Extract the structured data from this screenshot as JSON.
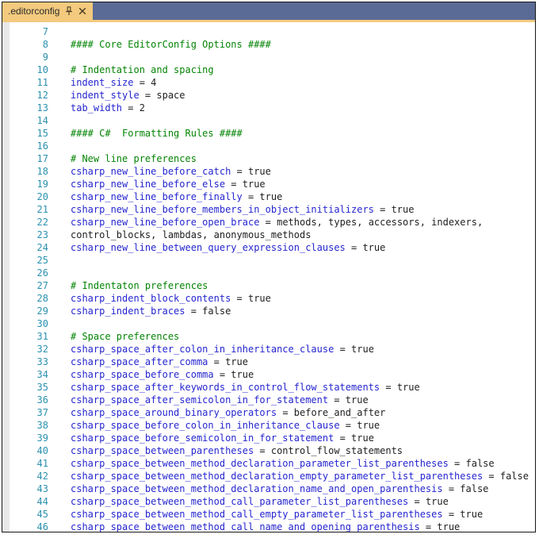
{
  "tab": {
    "title": ".editorconfig",
    "close_glyph": "✕",
    "pin_icon": "pushpin-pinned",
    "close_icon": "close-x"
  },
  "colors": {
    "tab_bar_background": "#5a6b96",
    "active_tab_background": "#f3ca7e",
    "line_number": "#2b91af",
    "comment_green": "#048404",
    "key_blue": "#2525cf",
    "value_text": "#1e1e1e",
    "gutter_gray": "#e8e8e8"
  },
  "editor": {
    "lines": [
      {
        "num": "7",
        "segs": []
      },
      {
        "num": "8",
        "segs": [
          {
            "c": "comment",
            "t": "#### Core EditorConfig Options ####"
          }
        ]
      },
      {
        "num": "9",
        "segs": []
      },
      {
        "num": "10",
        "segs": [
          {
            "c": "comment",
            "t": "# Indentation and spacing"
          }
        ]
      },
      {
        "num": "11",
        "segs": [
          {
            "c": "key",
            "t": "indent_size"
          },
          {
            "c": "val",
            "t": " = 4"
          }
        ]
      },
      {
        "num": "12",
        "segs": [
          {
            "c": "key",
            "t": "indent_style"
          },
          {
            "c": "val",
            "t": " = space"
          }
        ]
      },
      {
        "num": "13",
        "segs": [
          {
            "c": "key",
            "t": "tab_width"
          },
          {
            "c": "val",
            "t": " = 2"
          }
        ]
      },
      {
        "num": "14",
        "segs": []
      },
      {
        "num": "15",
        "segs": [
          {
            "c": "comment",
            "t": "#### C#  Formatting Rules ####"
          }
        ]
      },
      {
        "num": "16",
        "segs": []
      },
      {
        "num": "17",
        "segs": [
          {
            "c": "comment",
            "t": "# New line preferences"
          }
        ]
      },
      {
        "num": "18",
        "segs": [
          {
            "c": "key",
            "t": "csharp_new_line_before_catch"
          },
          {
            "c": "val",
            "t": " = true"
          }
        ]
      },
      {
        "num": "19",
        "segs": [
          {
            "c": "key",
            "t": "csharp_new_line_before_else"
          },
          {
            "c": "val",
            "t": " = true"
          }
        ]
      },
      {
        "num": "20",
        "segs": [
          {
            "c": "key",
            "t": "csharp_new_line_before_finally"
          },
          {
            "c": "val",
            "t": " = true"
          }
        ]
      },
      {
        "num": "21",
        "segs": [
          {
            "c": "key",
            "t": "csharp_new_line_before_members_in_object_initializers"
          },
          {
            "c": "val",
            "t": " = true"
          }
        ]
      },
      {
        "num": "22",
        "segs": [
          {
            "c": "key",
            "t": "csharp_new_line_before_open_brace"
          },
          {
            "c": "val",
            "t": " = methods, types, accessors, indexers,"
          }
        ]
      },
      {
        "num": "23",
        "segs": [
          {
            "c": "val",
            "t": "control_blocks, lambdas, anonymous_methods"
          }
        ]
      },
      {
        "num": "24",
        "segs": [
          {
            "c": "key",
            "t": "csharp_new_line_between_query_expression_clauses"
          },
          {
            "c": "val",
            "t": " = true"
          }
        ]
      },
      {
        "num": "25",
        "segs": []
      },
      {
        "num": "26",
        "segs": []
      },
      {
        "num": "27",
        "segs": [
          {
            "c": "comment",
            "t": "# Indentaton preferences"
          }
        ]
      },
      {
        "num": "28",
        "segs": [
          {
            "c": "key",
            "t": "csharp_indent_block_contents"
          },
          {
            "c": "val",
            "t": " = true"
          }
        ]
      },
      {
        "num": "29",
        "segs": [
          {
            "c": "key",
            "t": "csharp_indent_braces"
          },
          {
            "c": "val",
            "t": " = false"
          }
        ]
      },
      {
        "num": "30",
        "segs": []
      },
      {
        "num": "31",
        "segs": [
          {
            "c": "comment",
            "t": "# Space preferences"
          }
        ]
      },
      {
        "num": "32",
        "segs": [
          {
            "c": "key",
            "t": "csharp_space_after_colon_in_inheritance_clause"
          },
          {
            "c": "val",
            "t": " = true"
          }
        ]
      },
      {
        "num": "33",
        "segs": [
          {
            "c": "key",
            "t": "csharp_space_after_comma"
          },
          {
            "c": "val",
            "t": " = true"
          }
        ]
      },
      {
        "num": "34",
        "segs": [
          {
            "c": "key",
            "t": "csharp_space_before_comma"
          },
          {
            "c": "val",
            "t": " = true"
          }
        ]
      },
      {
        "num": "35",
        "segs": [
          {
            "c": "key",
            "t": "csharp_space_after_keywords_in_control_flow_statements"
          },
          {
            "c": "val",
            "t": " = true"
          }
        ]
      },
      {
        "num": "36",
        "segs": [
          {
            "c": "key",
            "t": "csharp_space_after_semicolon_in_for_statement"
          },
          {
            "c": "val",
            "t": " = true"
          }
        ]
      },
      {
        "num": "37",
        "segs": [
          {
            "c": "key",
            "t": "csharp_space_around_binary_operators"
          },
          {
            "c": "val",
            "t": " = before_and_after"
          }
        ]
      },
      {
        "num": "38",
        "segs": [
          {
            "c": "key",
            "t": "csharp_space_before_colon_in_inheritance_clause"
          },
          {
            "c": "val",
            "t": " = true"
          }
        ]
      },
      {
        "num": "39",
        "segs": [
          {
            "c": "key",
            "t": "csharp_space_before_semicolon_in_for_statement"
          },
          {
            "c": "val",
            "t": " = true"
          }
        ]
      },
      {
        "num": "40",
        "segs": [
          {
            "c": "key",
            "t": "csharp_space_between_parentheses"
          },
          {
            "c": "val",
            "t": " = control_flow_statements"
          }
        ]
      },
      {
        "num": "41",
        "segs": [
          {
            "c": "key",
            "t": "csharp_space_between_method_declaration_parameter_list_parentheses"
          },
          {
            "c": "val",
            "t": " = false"
          }
        ]
      },
      {
        "num": "42",
        "segs": [
          {
            "c": "key",
            "t": "csharp_space_between_method_declaration_empty_parameter_list_parentheses"
          },
          {
            "c": "val",
            "t": " = false"
          }
        ]
      },
      {
        "num": "43",
        "segs": [
          {
            "c": "key",
            "t": "csharp_space_between_method_declaration_name_and_open_parenthesis"
          },
          {
            "c": "val",
            "t": " = false"
          }
        ]
      },
      {
        "num": "44",
        "segs": [
          {
            "c": "key",
            "t": "csharp_space_between_method_call_parameter_list_parentheses"
          },
          {
            "c": "val",
            "t": " = true"
          }
        ]
      },
      {
        "num": "45",
        "segs": [
          {
            "c": "key",
            "t": "csharp_space_between_method_call_empty_parameter_list_parentheses"
          },
          {
            "c": "val",
            "t": " = true"
          }
        ]
      },
      {
        "num": "46",
        "segs": [
          {
            "c": "key",
            "t": "csharp_space_between_method_call_name_and_opening_parenthesis"
          },
          {
            "c": "val",
            "t": " = true"
          }
        ]
      }
    ]
  }
}
